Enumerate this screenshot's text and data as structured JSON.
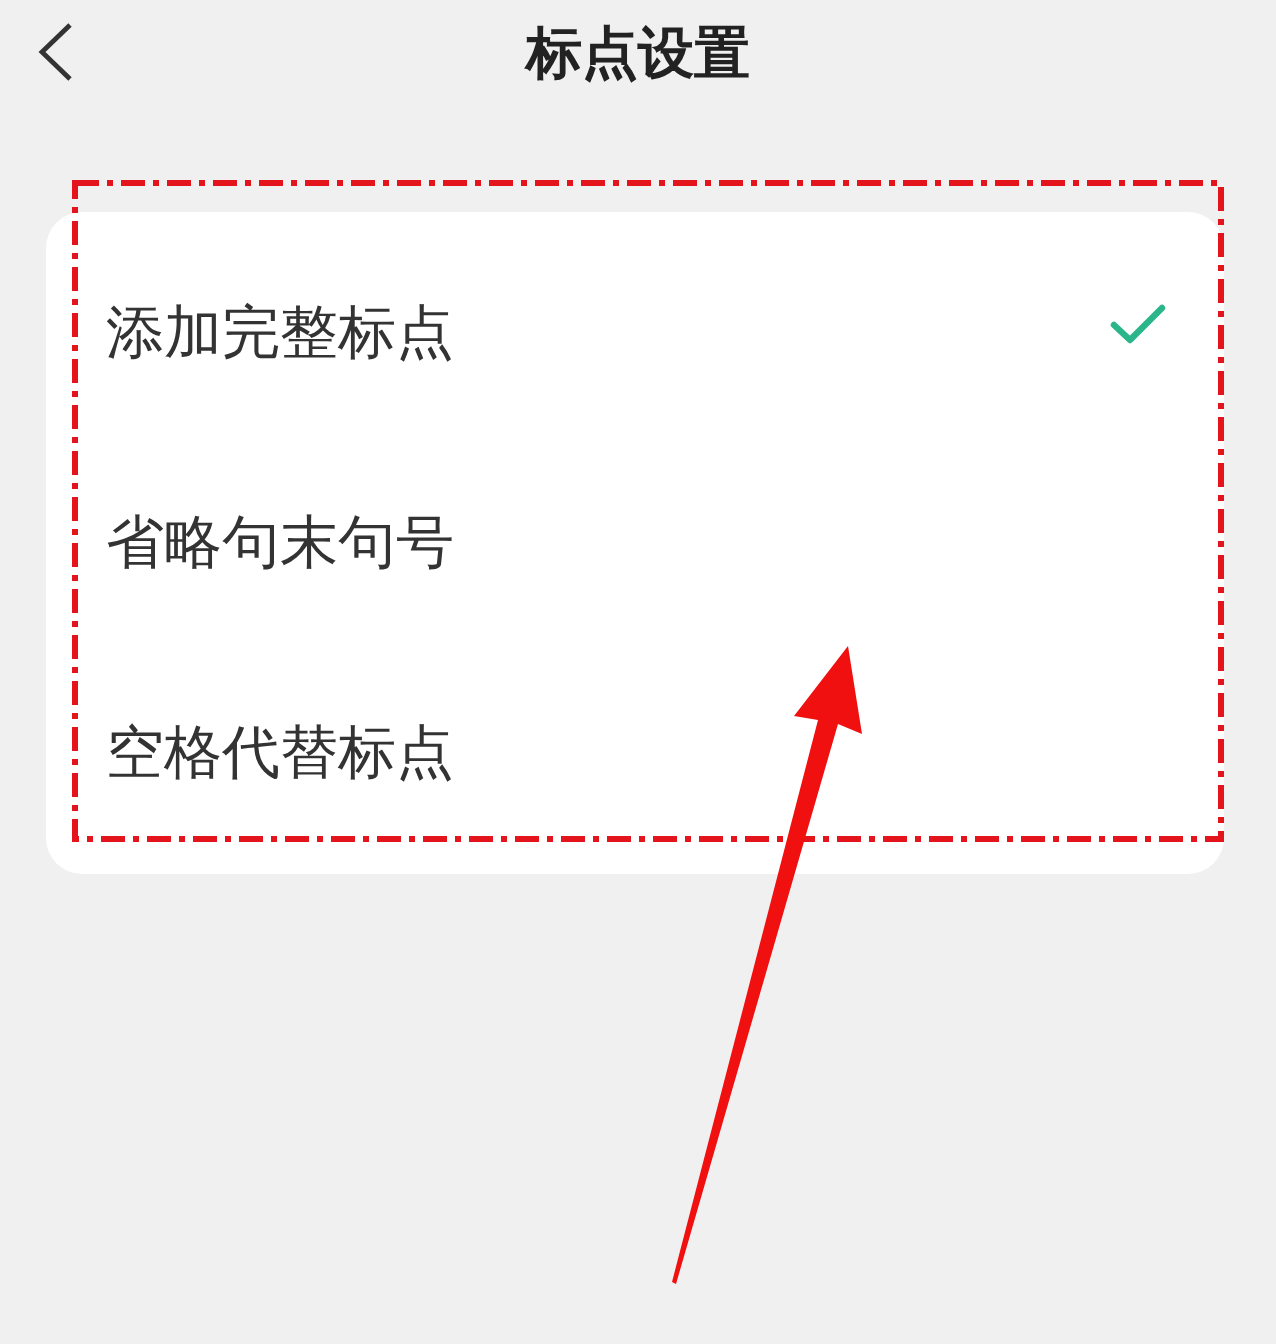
{
  "header": {
    "title": "标点设置"
  },
  "options": [
    {
      "label": "添加完整标点",
      "selected": true
    },
    {
      "label": "省略句末句号",
      "selected": false
    },
    {
      "label": "空格代替标点",
      "selected": false
    }
  ],
  "annotations": [
    {
      "kind": "frame"
    },
    {
      "kind": "arrow"
    }
  ]
}
